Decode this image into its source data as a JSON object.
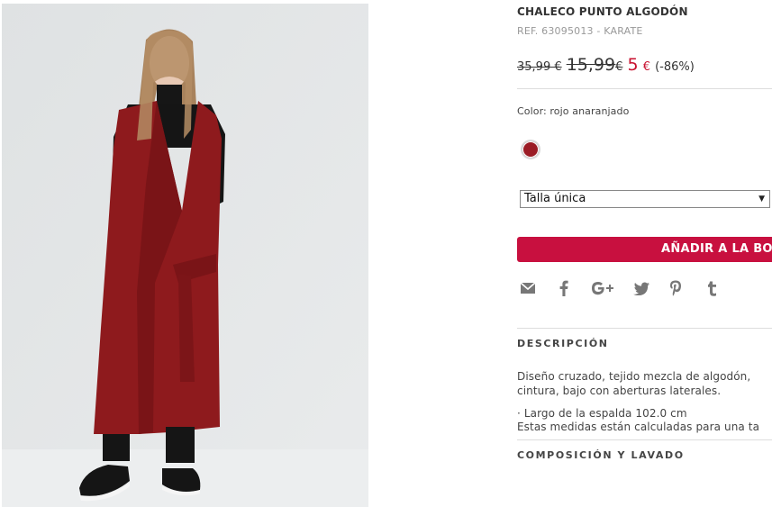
{
  "product": {
    "title": "CHALECO PUNTO ALGODÓN",
    "ref": "REF. 63095013 - KARATE",
    "image": "woman wearing a long red knit wrap vest with belt"
  },
  "pricing": {
    "original": "35,99 €",
    "previous_amount": "15,99",
    "previous_currency": "€",
    "current_amount": "5",
    "current_currency": "€",
    "discount": "(-86%)",
    "sale_color": "#c8102e"
  },
  "color": {
    "label": "Color: rojo anaranjado",
    "swatch_hex": "#9b1c25"
  },
  "size": {
    "selected": "Talla única"
  },
  "cart": {
    "button_label": "AÑADIR A LA BOLSA",
    "button_color": "#c8103f"
  },
  "share": {
    "icons": [
      "email-icon",
      "facebook-icon",
      "google-plus-icon",
      "twitter-icon",
      "pinterest-icon",
      "tumblr-icon"
    ]
  },
  "description": {
    "heading": "DESCRIPCIÓN",
    "line1": "Diseño cruzado, tejido mezcla de algodón, ",
    "line2": "cintura, bajo con aberturas laterales.",
    "line3": "· Largo de la espalda 102.0 cm",
    "line4": "Estas medidas están calculadas para una ta"
  },
  "composition": {
    "heading": "COMPOSICIÓN Y LAVADO"
  }
}
